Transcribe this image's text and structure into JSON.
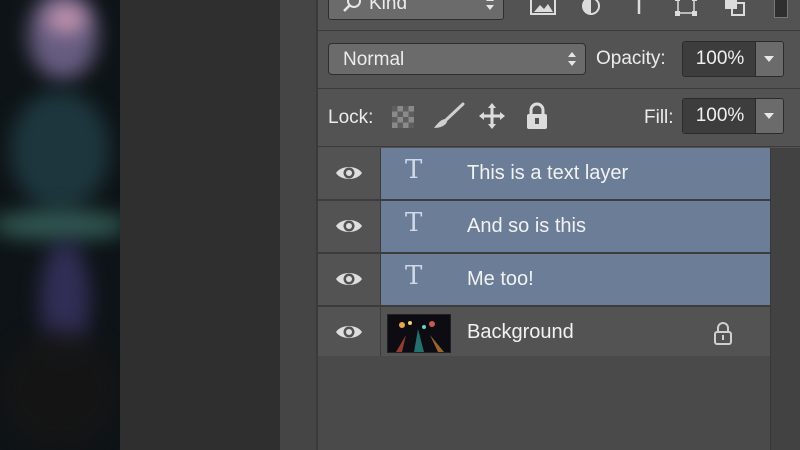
{
  "panel": {
    "filter": {
      "kind_label": "Kind",
      "icons": [
        "image-filter-icon",
        "adjustment-filter-icon",
        "type-filter-icon",
        "shape-filter-icon",
        "smart-object-filter-icon"
      ]
    },
    "blend_mode": "Normal",
    "opacity_label": "Opacity:",
    "opacity_value": "100%",
    "lock_label": "Lock:",
    "lock_icons": [
      "lock-transparent-pixels-icon",
      "lock-image-pixels-icon",
      "lock-position-icon",
      "lock-all-icon"
    ],
    "fill_label": "Fill:",
    "fill_value": "100%"
  },
  "layers": [
    {
      "name": "This is a text layer",
      "type": "text",
      "selected": true,
      "visible": true
    },
    {
      "name": "And so is this",
      "type": "text",
      "selected": true,
      "visible": true
    },
    {
      "name": "Me too!",
      "type": "text",
      "selected": true,
      "visible": true
    },
    {
      "name": "Background",
      "type": "image",
      "selected": false,
      "visible": true,
      "locked": true
    }
  ],
  "colors": {
    "panel_bg": "#535353",
    "selected_layer": "#6b7d97",
    "field_bg": "#3d3d3d"
  }
}
